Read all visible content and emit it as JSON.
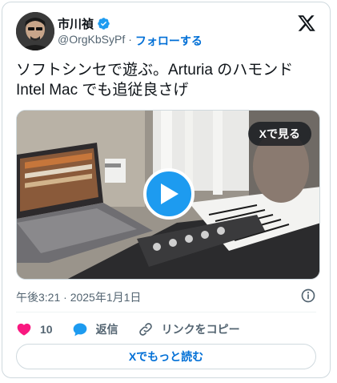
{
  "author": {
    "name": "市川禎",
    "handle": "@OrgKbSyPf",
    "separator": "·",
    "follow_label": "フォローする"
  },
  "tweet": {
    "text_line1": "ソフトシンセで遊ぶ。Arturia のハモンド",
    "text_line2": "Intel Mac でも追従良さげ"
  },
  "media": {
    "watch_on_x_label": "Xで見る"
  },
  "meta": {
    "timestamp": "午後3:21 · 2025年1月1日"
  },
  "actions": {
    "like_count": "10",
    "reply_label": "返信",
    "copy_link_label": "リンクをコピー"
  },
  "read_more_label": "Xでもっと読む",
  "colors": {
    "accent": "#1d9bf0",
    "link": "#006fd6",
    "like": "#f91880",
    "text_secondary": "#536471",
    "border": "#cfd9de"
  },
  "icons": [
    "x-logo-icon",
    "verified-badge-icon",
    "play-icon",
    "info-icon",
    "heart-icon",
    "reply-bubble-icon",
    "link-icon"
  ]
}
